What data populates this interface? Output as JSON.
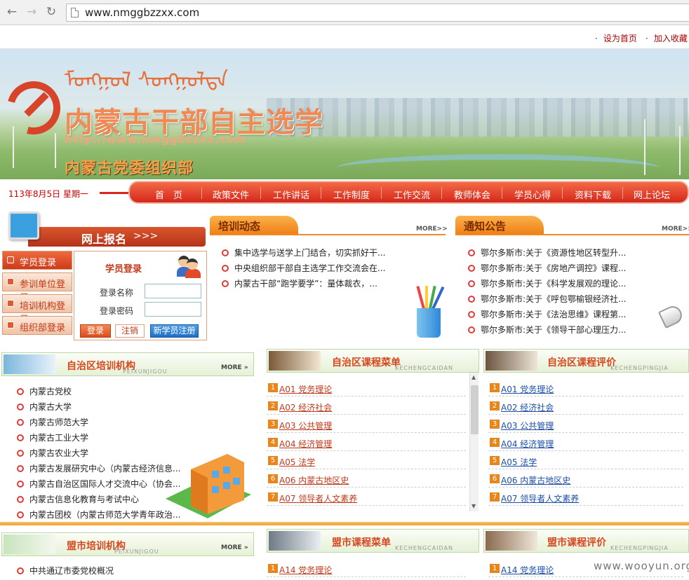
{
  "browser": {
    "url": "www.nmggbzzxx.com"
  },
  "toplinks": {
    "home": "设为首页",
    "fav": "加入收藏"
  },
  "banner": {
    "mongol": "ᠮᠣᠩᠭᠣᠯ ᠰᠤᠩᠭᠤᠯᠲᠠ",
    "title": "内蒙古干部自主选学",
    "url": "http://www.nmggbzzxx.com",
    "org": "内蒙古党委组织部"
  },
  "date": "113年8月5日 星期一",
  "nav": [
    "首　页",
    "政策文件",
    "工作讲话",
    "工作制度",
    "工作交流",
    "教师体会",
    "学员心得",
    "资料下载",
    "网上论坛"
  ],
  "signup": {
    "title": "网上报名",
    "arrows": ">>>"
  },
  "login_menu": [
    "学员登录",
    "参训单位登录",
    "培训机构登录",
    "组织部登录"
  ],
  "login": {
    "title": "学员登录",
    "user_label": "登录名称",
    "pass_label": "登录密码",
    "btn_login": "登录",
    "btn_logout": "注销",
    "btn_register": "新学员注册"
  },
  "training_news": {
    "title": "培训动态",
    "more": "MORE>>",
    "items": [
      "集中选学与送学上门结合，切实抓好干...",
      "中央组织部干部自主选学工作交流会在...",
      "内蒙古干部“跑学要学”：量体裁衣，..."
    ]
  },
  "notices": {
    "title": "通知公告",
    "more": "MORE>>",
    "items": [
      "鄂尔多斯市:关于《资源性地区转型升...",
      "鄂尔多斯市:关于《房地产调控》课程...",
      "鄂尔多斯市:关于《科学发展观的理论...",
      "鄂尔多斯市:关于《呼包鄂榆银经济社...",
      "鄂尔多斯市:关于《法治思维》课程第...",
      "鄂尔多斯市:关于《领导干部心理压力..."
    ]
  },
  "region_inst": {
    "title": "自治区培训机构",
    "pinyin": "PEIXUNJIGOU",
    "more": "MORE »",
    "items": [
      "内蒙古党校",
      "内蒙古大学",
      "内蒙古师范大学",
      "内蒙古工业大学",
      "内蒙古农业大学",
      "内蒙古发展研究中心（内蒙古经济信息...",
      "内蒙古自治区国际人才交流中心（协会...",
      "内蒙古信息化教育与考试中心",
      "内蒙古团校（内蒙古师范大学青年政治..."
    ]
  },
  "region_courses": {
    "title": "自治区课程菜单",
    "pinyin": "KECHENGCAIDAN",
    "items": [
      {
        "n": "1",
        "t": "A01 党务理论"
      },
      {
        "n": "2",
        "t": "A02 经济社会"
      },
      {
        "n": "3",
        "t": "A03 公共管理"
      },
      {
        "n": "4",
        "t": "A04 经济管理"
      },
      {
        "n": "5",
        "t": "A05 法学"
      },
      {
        "n": "6",
        "t": "A06 内蒙古地区史"
      },
      {
        "n": "7",
        "t": "A07 领导者人文素养"
      }
    ]
  },
  "region_eval": {
    "title": "自治区课程评价",
    "pinyin": "KECHENGPINGJIA",
    "items": [
      {
        "n": "1",
        "t": "A01 党务理论"
      },
      {
        "n": "2",
        "t": "A02 经济社会"
      },
      {
        "n": "3",
        "t": "A03 公共管理"
      },
      {
        "n": "4",
        "t": "A04 经济管理"
      },
      {
        "n": "5",
        "t": "A05 法学"
      },
      {
        "n": "6",
        "t": "A06 内蒙古地区史"
      },
      {
        "n": "7",
        "t": "A07 领导者人文素养"
      }
    ]
  },
  "city_inst": {
    "title": "盟市培训机构",
    "pinyin": "PEIXUNJIGOU",
    "more": "MORE »",
    "items": [
      "中共通辽市委党校概况"
    ]
  },
  "city_courses": {
    "title": "盟市课程菜单",
    "pinyin": "KECHENGCAIDAN",
    "items": [
      {
        "n": "1",
        "t": "A14 党务理论"
      }
    ]
  },
  "city_eval": {
    "title": "盟市课程评价",
    "pinyin": "KECHENGPINGJIA",
    "items": [
      {
        "n": "1",
        "t": "A14 党务理论"
      }
    ]
  },
  "watermark": "www.wooyun.org",
  "colors": {
    "accent_red": "#d5271c",
    "accent_orange": "#ee7e14",
    "link_blue": "#1c4fa8"
  }
}
